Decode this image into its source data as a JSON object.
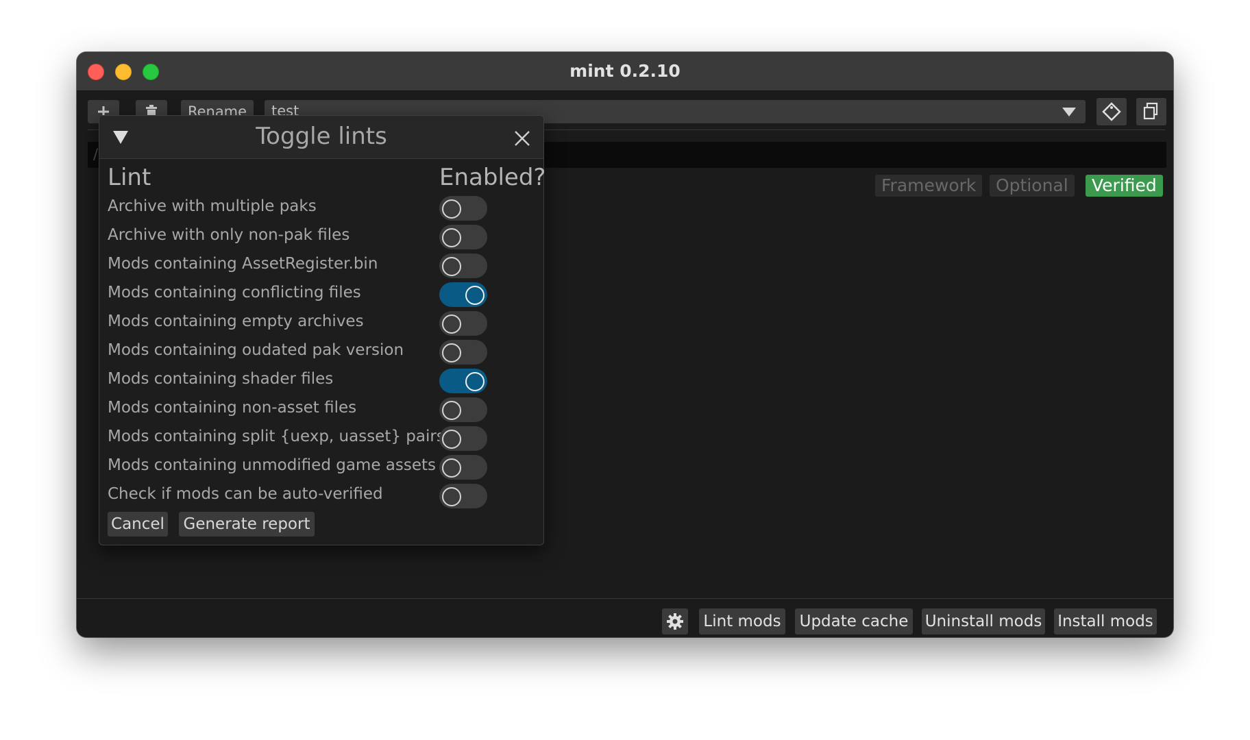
{
  "window": {
    "title": "mint 0.2.10"
  },
  "toolbar": {
    "add_icon": "plus-icon",
    "delete_icon": "trash-icon",
    "rename_label": "Rename",
    "profile_value": "test",
    "tag_icon": "tag-icon",
    "copy_icon": "copy-icon"
  },
  "filters": [
    {
      "label": "Framework",
      "active": false
    },
    {
      "label": "Optional",
      "active": false
    },
    {
      "label": "Verified",
      "active": true
    }
  ],
  "dialog": {
    "title": "Toggle lints",
    "col_lint": "Lint",
    "col_enabled": "Enabled?",
    "rows": [
      {
        "label": "Archive with multiple paks",
        "enabled": false
      },
      {
        "label": "Archive with only non-pak files",
        "enabled": false
      },
      {
        "label": "Mods containing AssetRegister.bin",
        "enabled": false
      },
      {
        "label": "Mods containing conflicting files",
        "enabled": true
      },
      {
        "label": "Mods containing empty archives",
        "enabled": false
      },
      {
        "label": "Mods containing oudated pak version",
        "enabled": false
      },
      {
        "label": "Mods containing shader files",
        "enabled": true
      },
      {
        "label": "Mods containing non-asset files",
        "enabled": false
      },
      {
        "label": "Mods containing split {uexp, uasset} pairs",
        "enabled": false
      },
      {
        "label": "Mods containing unmodified game assets",
        "enabled": false
      },
      {
        "label": "Check if mods can be auto-verified",
        "enabled": false
      }
    ],
    "cancel_label": "Cancel",
    "generate_label": "Generate report"
  },
  "statusbar": {
    "gear_icon": "gear-icon",
    "lint_label": "Lint mods",
    "update_label": "Update cache",
    "uninstall_label": "Uninstall mods",
    "install_label": "Install mods"
  },
  "colors": {
    "accent_toggle_on": "#0a5a86",
    "verified_chip": "#3c9a4f",
    "traffic_close": "#ff5f57",
    "traffic_min": "#febc2e",
    "traffic_max": "#28c840"
  }
}
